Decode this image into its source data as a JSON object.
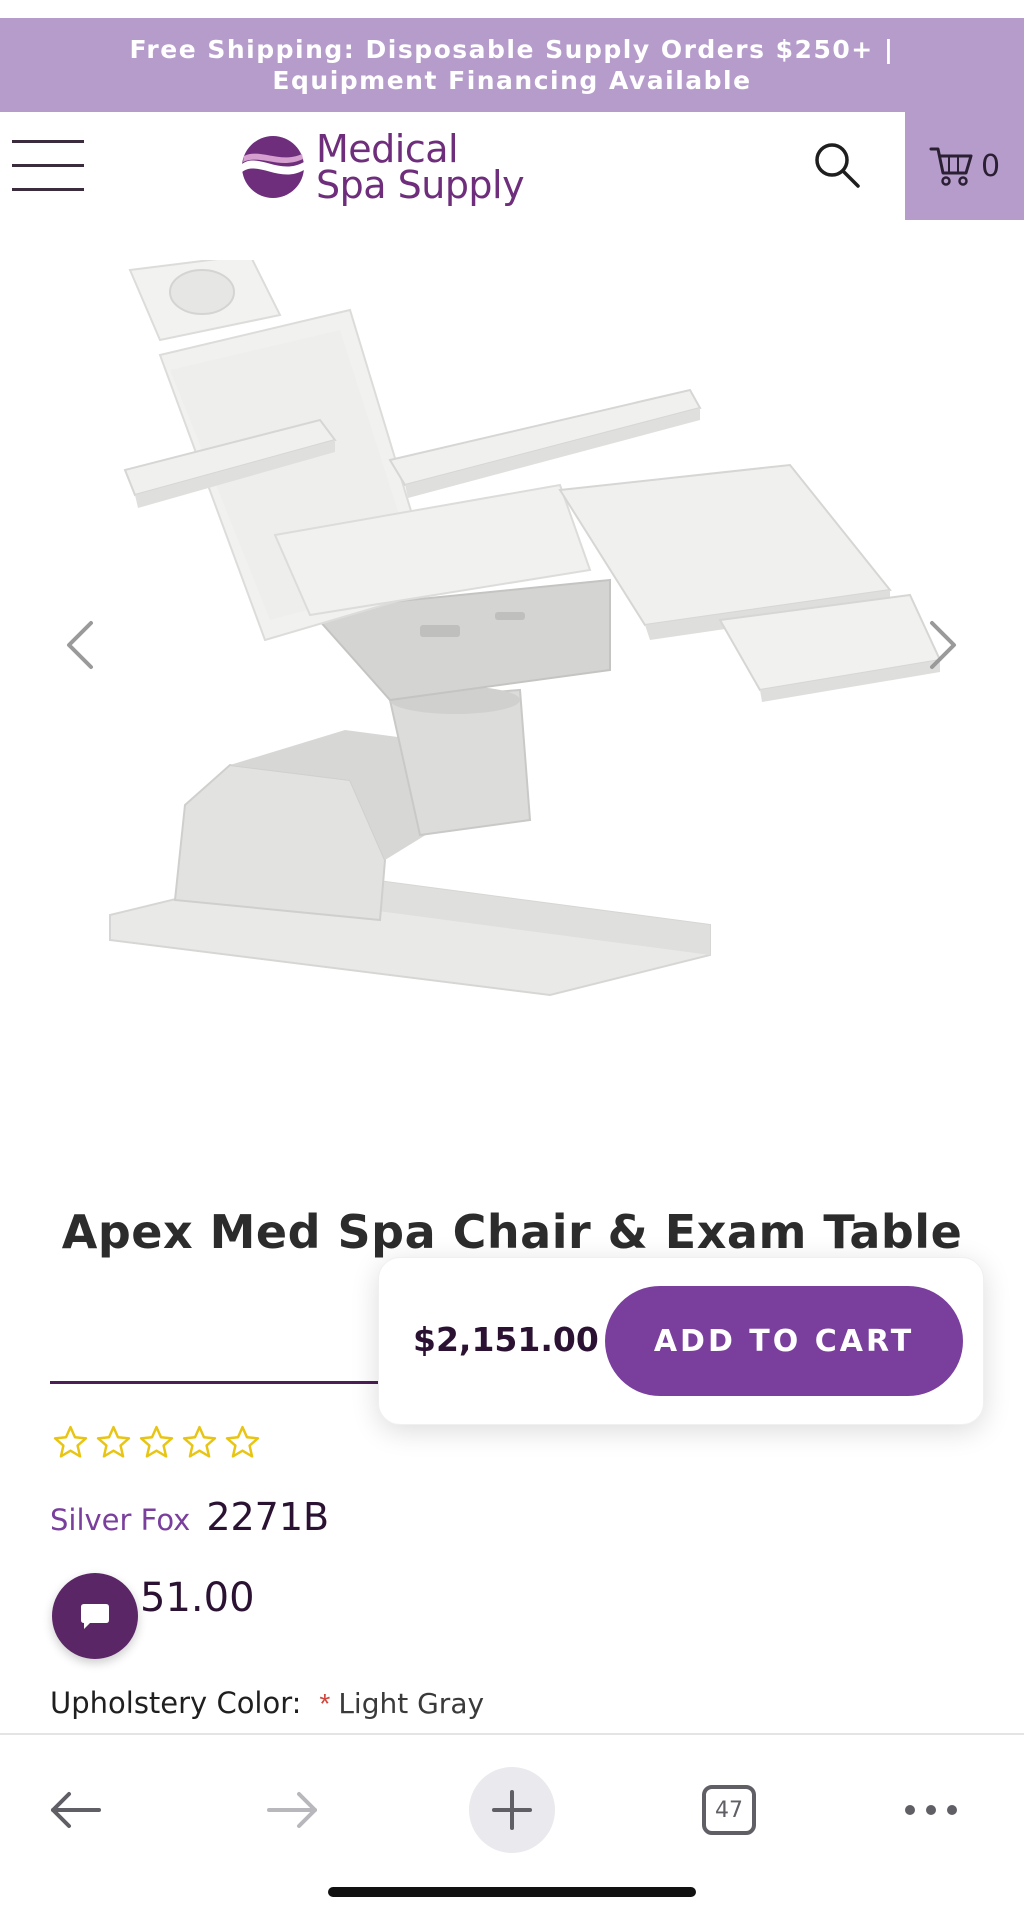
{
  "promo": {
    "line1": "Free Shipping: Disposable Supply Orders $250+ |",
    "line2": "Equipment Financing Available",
    "background": "#b69ccb"
  },
  "header": {
    "menu_icon": "hamburger-menu-icon",
    "logo_line1": "Medical",
    "logo_line2": "Spa Supply",
    "search_icon": "search-icon",
    "cart_icon": "shopping-cart-icon",
    "cart_count": "0",
    "brand_color": "#6e2e7c"
  },
  "gallery": {
    "image_name": "white-spa-chair-image",
    "prev_icon": "chevron-left-icon",
    "next_icon": "chevron-right-icon"
  },
  "product": {
    "title": "Apex Med Spa Chair & Exam Table",
    "rating": 0,
    "rating_max": 5,
    "brand": "Silver Fox",
    "sku": "2271B",
    "price_visible": "51.00",
    "option_label": "Upholstery Color:",
    "option_required_mark": "*",
    "option_value": "Light Gray"
  },
  "sticky_cart": {
    "price": "$2,151.00",
    "button_label": "ADD TO CART",
    "button_color": "#7a3f9d"
  },
  "chat": {
    "icon": "chat-bubble-icon"
  },
  "browser_bar": {
    "back_icon": "arrow-left-icon",
    "forward_icon": "arrow-right-icon",
    "new_tab_icon": "plus-icon",
    "tab_count": "47",
    "more_icon": "more-dots-icon"
  }
}
